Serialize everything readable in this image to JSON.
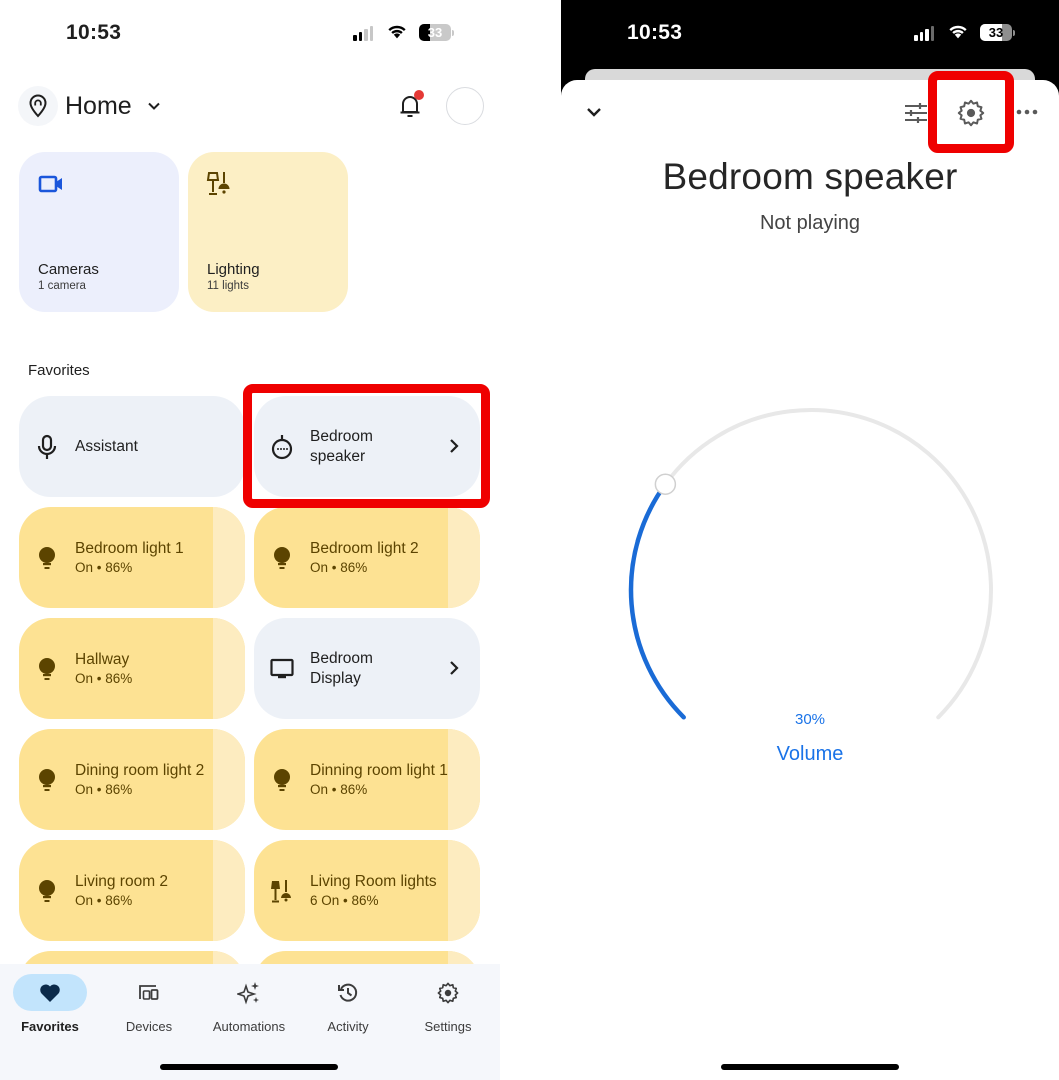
{
  "left_screen": {
    "status_bar": {
      "time": "10:53",
      "battery": "33"
    },
    "header": {
      "home_name": "Home",
      "notification_badge": true
    },
    "categories": [
      {
        "name": "Cameras",
        "sub": "1 camera",
        "icon": "video-camera-icon",
        "color": "#1a56db"
      },
      {
        "name": "Lighting",
        "sub": "11 lights",
        "icon": "lamp-icon",
        "color": "#5c4400"
      }
    ],
    "favorites_label": "Favorites",
    "favorites": [
      {
        "name": "Assistant",
        "sub": "",
        "icon": "microphone-icon",
        "type": "gray"
      },
      {
        "name": "Bedroom speaker",
        "sub": "",
        "icon": "speaker-icon",
        "type": "gray",
        "chevron": true,
        "highlighted": true
      },
      {
        "name": "Bedroom light 1",
        "sub": "On • 86%",
        "icon": "bulb-icon",
        "type": "light",
        "brightness": 86
      },
      {
        "name": "Bedroom light 2",
        "sub": "On • 86%",
        "icon": "bulb-icon",
        "type": "light",
        "brightness": 86
      },
      {
        "name": "Hallway",
        "sub": "On • 86%",
        "icon": "bulb-icon",
        "type": "light",
        "brightness": 86
      },
      {
        "name": "Bedroom Display",
        "sub": "",
        "icon": "display-icon",
        "type": "gray",
        "chevron": true
      },
      {
        "name": "Dining room light 2",
        "sub": "On • 86%",
        "icon": "bulb-icon",
        "type": "light",
        "brightness": 86
      },
      {
        "name": "Dinning room light 1",
        "sub": "On • 86%",
        "icon": "bulb-icon",
        "type": "light",
        "brightness": 86
      },
      {
        "name": "Living room 2",
        "sub": "On • 86%",
        "icon": "bulb-icon",
        "type": "light",
        "brightness": 86
      },
      {
        "name": "Living Room lights",
        "sub": "6 On • 86%",
        "icon": "lamp-icon",
        "type": "light",
        "brightness": 86
      }
    ],
    "bottom_nav": [
      {
        "label": "Favorites",
        "icon": "heart-icon",
        "active": true
      },
      {
        "label": "Devices",
        "icon": "devices-icon",
        "active": false
      },
      {
        "label": "Automations",
        "icon": "sparkle-icon",
        "active": false
      },
      {
        "label": "Activity",
        "icon": "history-icon",
        "active": false
      },
      {
        "label": "Settings",
        "icon": "gear-icon",
        "active": false
      }
    ]
  },
  "right_screen": {
    "status_bar": {
      "time": "10:53",
      "battery": "33"
    },
    "device_title": "Bedroom speaker",
    "device_status": "Not playing",
    "volume": {
      "percent": 30,
      "label": "30%",
      "caption": "Volume"
    },
    "colors": {
      "accent": "#1a73e8",
      "highlight": "#ef0000"
    }
  }
}
